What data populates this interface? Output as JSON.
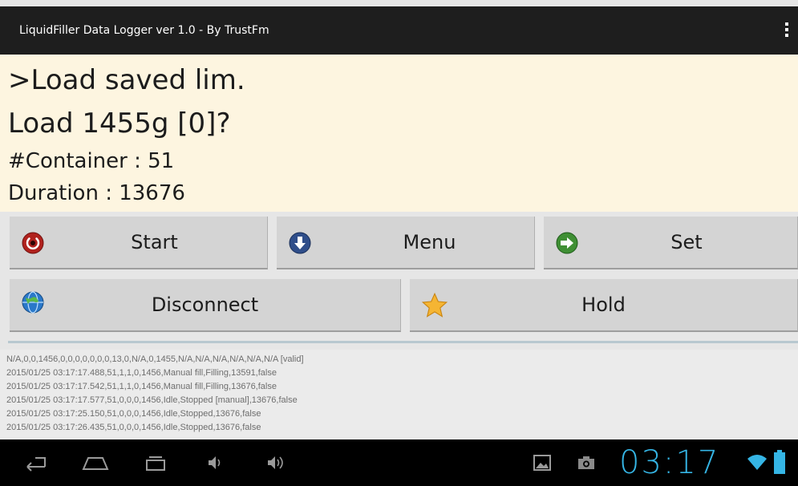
{
  "app": {
    "title": "LiquidFiller Data Logger ver 1.0 - By TrustFm"
  },
  "display": {
    "line1": ">Load saved lim.",
    "line2": "Load 1455g [0]?",
    "line3": "#Container : 51",
    "line4": "Duration : 13676"
  },
  "buttons": {
    "start": "Start",
    "menu": "Menu",
    "set": "Set",
    "disconnect": "Disconnect",
    "hold": "Hold"
  },
  "log": [
    "N/A,0,0,1456,0,0,0,0,0,0,0,13,0,N/A,0,1455,N/A,N/A,N/A,N/A,N/A,N/A [valid]",
    "2015/01/25 03:17:17.488,51,1,1,0,1456,Manual fill,Filling,13591,false",
    "2015/01/25 03:17:17.542,51,1,1,0,1456,Manual fill,Filling,13676,false",
    "2015/01/25 03:17:17.577,51,0,0,0,1456,Idle,Stopped [manual],13676,false",
    "2015/01/25 03:17:25.150,51,0,0,0,1456,Idle,Stopped,13676,false",
    "2015/01/25 03:17:26.435,51,0,0,0,1456,Idle,Stopped,13676,false"
  ],
  "status_bar": {
    "clock": "03:17"
  },
  "colors": {
    "action_bar": "#1e1e1e",
    "display_bg": "#fdf5e0",
    "button_bg": "#d4d4d4",
    "clock": "#35b5e5"
  },
  "icons": {
    "start": "power-icon",
    "menu": "arrow-down-circle-icon",
    "set": "arrow-right-circle-icon",
    "disconnect": "globe-icon",
    "hold": "star-icon"
  }
}
